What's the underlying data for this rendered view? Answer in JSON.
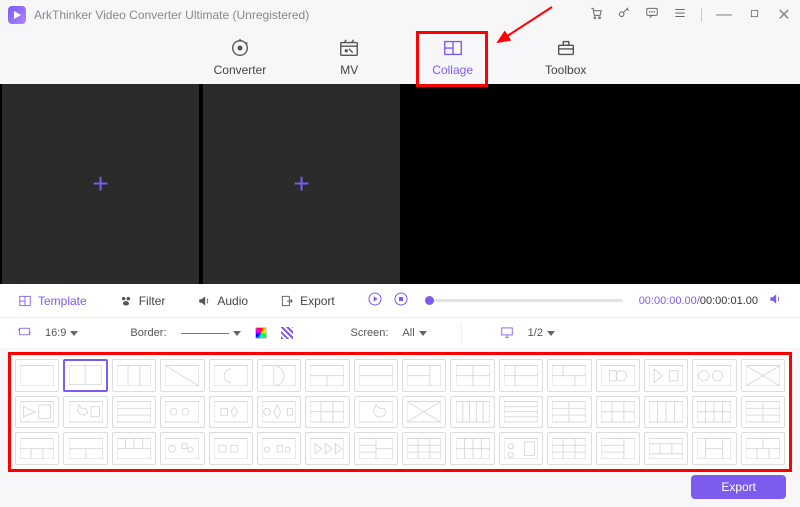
{
  "app": {
    "title": "ArkThinker Video Converter Ultimate (Unregistered)"
  },
  "titlebar_icons": [
    "cart",
    "key",
    "feedback",
    "menu",
    "sep",
    "minimize",
    "maximize",
    "close"
  ],
  "tabs": [
    {
      "id": "converter",
      "label": "Converter",
      "active": false
    },
    {
      "id": "mv",
      "label": "MV",
      "active": false
    },
    {
      "id": "collage",
      "label": "Collage",
      "active": true
    },
    {
      "id": "toolbox",
      "label": "Toolbox",
      "active": false
    }
  ],
  "subtabs": {
    "template": "Template",
    "filter": "Filter",
    "audio": "Audio",
    "export": "Export"
  },
  "player": {
    "current": "00:00:00.00",
    "total": "00:00:01.00"
  },
  "options": {
    "ratio": "16:9",
    "borderLabel": "Border:",
    "screenLabel": "Screen:",
    "screenValue": "All",
    "preview": "1/2"
  },
  "exportLabel": "Export",
  "templateCount": 48
}
